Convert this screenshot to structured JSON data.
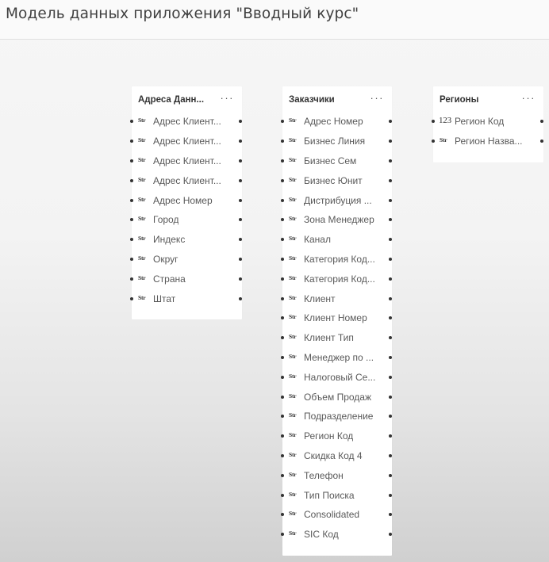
{
  "page": {
    "title": "Модель данных приложения \"Вводный курс\""
  },
  "tables": [
    {
      "title": "Адреса Данн...",
      "menu": "···",
      "fields": [
        {
          "type": "Str",
          "name": "Адрес Клиент..."
        },
        {
          "type": "Str",
          "name": "Адрес Клиент..."
        },
        {
          "type": "Str",
          "name": "Адрес Клиент..."
        },
        {
          "type": "Str",
          "name": "Адрес Клиент..."
        },
        {
          "type": "Str",
          "name": "Адрес Номер"
        },
        {
          "type": "Str",
          "name": "Город"
        },
        {
          "type": "Str",
          "name": "Индекс"
        },
        {
          "type": "Str",
          "name": "Округ"
        },
        {
          "type": "Str",
          "name": "Страна"
        },
        {
          "type": "Str",
          "name": "Штат"
        }
      ]
    },
    {
      "title": "Заказчики",
      "menu": "···",
      "fields": [
        {
          "type": "Str",
          "name": "Адрес Номер"
        },
        {
          "type": "Str",
          "name": "Бизнес Линия"
        },
        {
          "type": "Str",
          "name": "Бизнес Сем"
        },
        {
          "type": "Str",
          "name": "Бизнес Юнит"
        },
        {
          "type": "Str",
          "name": "Дистрибуция ..."
        },
        {
          "type": "Str",
          "name": "Зона Менеджер"
        },
        {
          "type": "Str",
          "name": "Канал"
        },
        {
          "type": "Str",
          "name": "Категория Код..."
        },
        {
          "type": "Str",
          "name": "Категория Код..."
        },
        {
          "type": "Str",
          "name": "Клиент"
        },
        {
          "type": "Str",
          "name": "Клиент Номер"
        },
        {
          "type": "Str",
          "name": "Клиент Тип"
        },
        {
          "type": "Str",
          "name": "Менеджер по ..."
        },
        {
          "type": "Str",
          "name": "Налоговый Се..."
        },
        {
          "type": "Str",
          "name": "Объем Продаж"
        },
        {
          "type": "Str",
          "name": "Подразделение"
        },
        {
          "type": "Str",
          "name": "Регион Код"
        },
        {
          "type": "Str",
          "name": "Скидка Код 4"
        },
        {
          "type": "Str",
          "name": "Телефон"
        },
        {
          "type": "Str",
          "name": "Тип Поиска"
        },
        {
          "type": "Str",
          "name": "Consolidated"
        },
        {
          "type": "Str",
          "name": "SIC Код"
        }
      ]
    },
    {
      "title": "Регионы",
      "menu": "···",
      "fields": [
        {
          "type": "123",
          "name": "Регион Код"
        },
        {
          "type": "Str",
          "name": "Регион Назва..."
        }
      ]
    }
  ]
}
